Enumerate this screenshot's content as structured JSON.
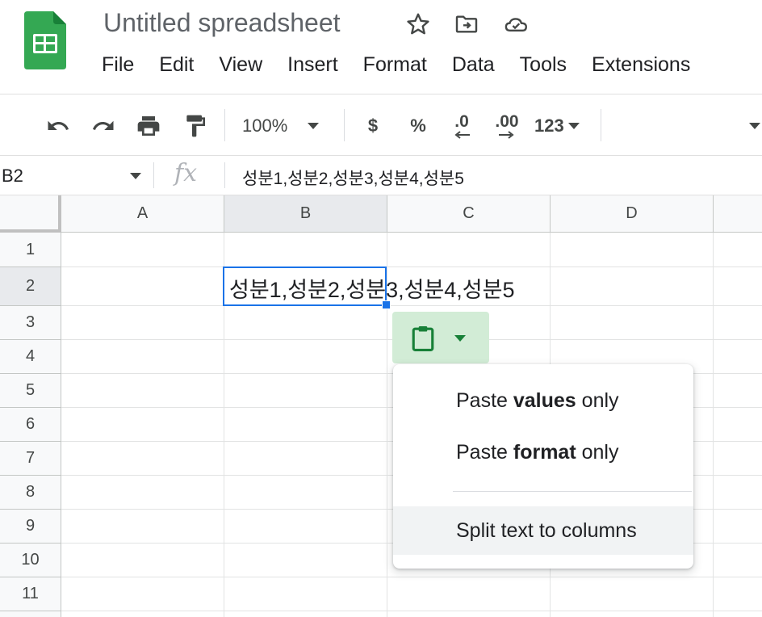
{
  "app": {
    "doc_title": "Untitled spreadsheet",
    "title_icons": [
      "star-icon",
      "move-folder-icon",
      "cloud-status-icon"
    ]
  },
  "menu": [
    "File",
    "Edit",
    "View",
    "Insert",
    "Format",
    "Data",
    "Tools",
    "Extensions"
  ],
  "toolbar": {
    "zoom": "100%",
    "currency": "$",
    "percent": "%",
    "decrease_decimal": ".0",
    "increase_decimal": ".00",
    "more_formats": "123"
  },
  "formula_bar": {
    "name_box": "B2",
    "fx": "fx",
    "content": "성분1,성분2,성분3,성분4,성분5"
  },
  "grid": {
    "columns": [
      "A",
      "B",
      "C",
      "D"
    ],
    "rows": [
      "1",
      "2",
      "3",
      "4",
      "5",
      "6",
      "7",
      "8",
      "9",
      "10",
      "11"
    ],
    "selected_cell": "B2",
    "cell_b2": "성분1,성분2,성분3,성분4,성분5"
  },
  "paste_menu": {
    "values_pre": "Paste ",
    "values_bold": "values",
    "values_post": " only",
    "format_pre": "Paste ",
    "format_bold": "format",
    "format_post": " only",
    "split": "Split text to columns"
  },
  "colors": {
    "brand_green": "#34a853",
    "selection_blue": "#1a73e8",
    "chip_green": "#d2ecd6"
  }
}
